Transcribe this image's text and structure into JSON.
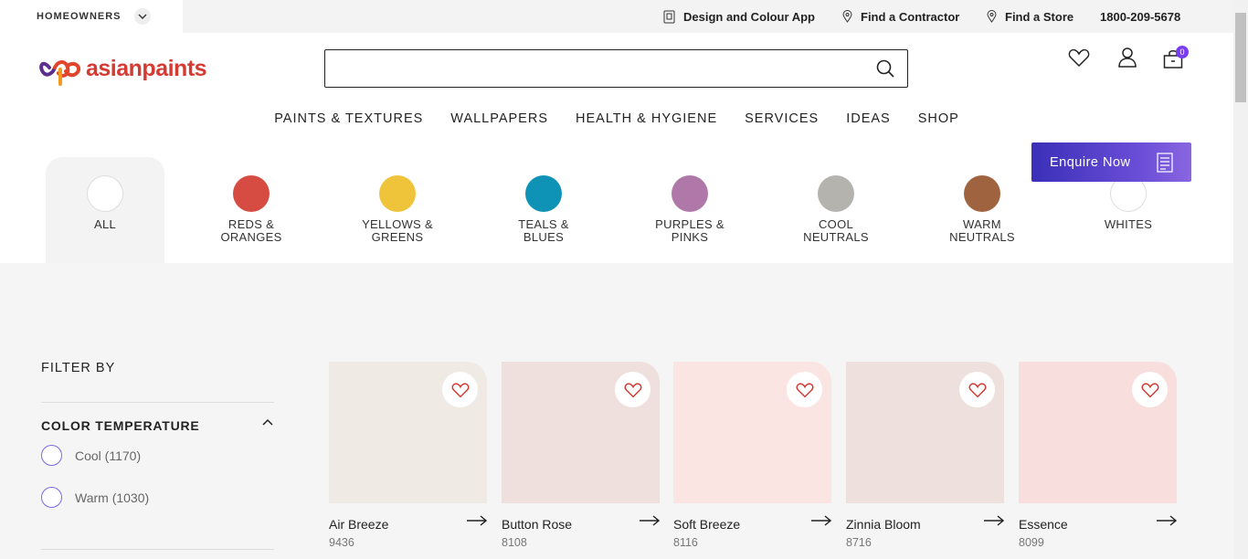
{
  "topbar": {
    "segment_label": "HOMEOWNERS",
    "links": {
      "design_app": "Design and Colour App",
      "find_contractor": "Find a Contractor",
      "find_store": "Find a Store",
      "phone": "1800-209-5678"
    }
  },
  "header": {
    "logo_text": "asianpaints",
    "brand_color": "#d43b33",
    "search": {
      "value": "",
      "placeholder": ""
    },
    "cart_count": "0",
    "icons": [
      "heart-icon",
      "user-icon",
      "cart-icon"
    ]
  },
  "nav": [
    "PAINTS & TEXTURES",
    "WALLPAPERS",
    "HEALTH & HYGIENE",
    "SERVICES",
    "IDEAS",
    "SHOP"
  ],
  "enquire": {
    "label": "Enquire Now",
    "accent": "#3a2fb8"
  },
  "families": [
    {
      "line1": "ALL",
      "line2": "",
      "color": "#ffffff"
    },
    {
      "line1": "REDS &",
      "line2": "ORANGES",
      "color": "#d64c43"
    },
    {
      "line1": "YELLOWS &",
      "line2": "GREENS",
      "color": "#efc43a"
    },
    {
      "line1": "TEALS &",
      "line2": "BLUES",
      "color": "#0e93b6"
    },
    {
      "line1": "PURPLES &",
      "line2": "PINKS",
      "color": "#b078a8"
    },
    {
      "line1": "COOL",
      "line2": "NEUTRALS",
      "color": "#b4b3ae"
    },
    {
      "line1": "WARM",
      "line2": "NEUTRALS",
      "color": "#a0633f"
    },
    {
      "line1": "WHITES",
      "line2": "",
      "color": "#ffffff"
    }
  ],
  "filters": {
    "title": "FILTER BY",
    "color_temperature": {
      "title": "COLOR TEMPERATURE",
      "options": [
        "Cool (1170)",
        "Warm (1030)"
      ]
    }
  },
  "colors": [
    {
      "name": "Air Breeze",
      "code": "9436",
      "hex": "#efeae4"
    },
    {
      "name": "Button Rose",
      "code": "8108",
      "hex": "#f0e0dd"
    },
    {
      "name": "Soft Breeze",
      "code": "8116",
      "hex": "#fae5e2"
    },
    {
      "name": "Zinnia Bloom",
      "code": "8716",
      "hex": "#ede0dd"
    },
    {
      "name": "Essence",
      "code": "8099",
      "hex": "#f8dedc"
    }
  ]
}
